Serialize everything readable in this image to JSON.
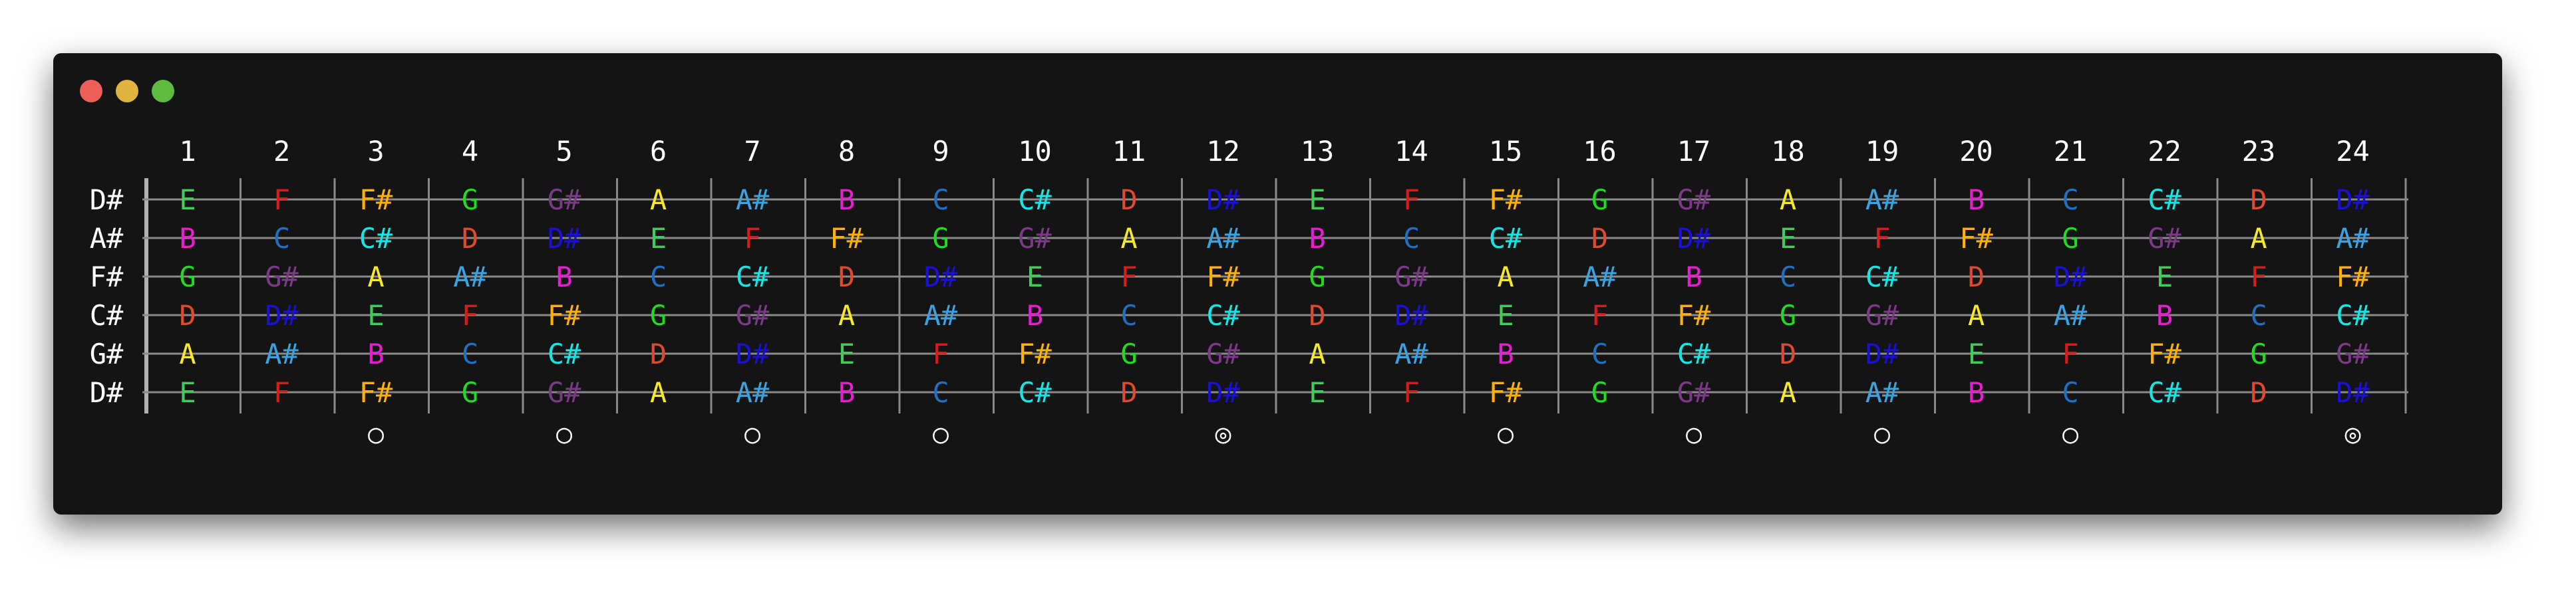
{
  "window": {
    "controls": [
      "close",
      "minimize",
      "maximize"
    ]
  },
  "fret_numbers": [
    "1",
    "2",
    "3",
    "4",
    "5",
    "6",
    "7",
    "8",
    "9",
    "10",
    "11",
    "12",
    "13",
    "14",
    "15",
    "16",
    "17",
    "18",
    "19",
    "20",
    "21",
    "22",
    "23",
    "24"
  ],
  "strings": [
    {
      "open": "D#",
      "notes": [
        "E",
        "F",
        "F#",
        "G",
        "G#",
        "A",
        "A#",
        "B",
        "C",
        "C#",
        "D",
        "D#",
        "E",
        "F",
        "F#",
        "G",
        "G#",
        "A",
        "A#",
        "B",
        "C",
        "C#",
        "D",
        "D#"
      ]
    },
    {
      "open": "A#",
      "notes": [
        "B",
        "C",
        "C#",
        "D",
        "D#",
        "E",
        "F",
        "F#",
        "G",
        "G#",
        "A",
        "A#",
        "B",
        "C",
        "C#",
        "D",
        "D#",
        "E",
        "F",
        "F#",
        "G",
        "G#",
        "A",
        "A#"
      ]
    },
    {
      "open": "F#",
      "notes": [
        "G",
        "G#",
        "A",
        "A#",
        "B",
        "C",
        "C#",
        "D",
        "D#",
        "E",
        "F",
        "F#",
        "G",
        "G#",
        "A",
        "A#",
        "B",
        "C",
        "C#",
        "D",
        "D#",
        "E",
        "F",
        "F#"
      ]
    },
    {
      "open": "C#",
      "notes": [
        "D",
        "D#",
        "E",
        "F",
        "F#",
        "G",
        "G#",
        "A",
        "A#",
        "B",
        "C",
        "C#",
        "D",
        "D#",
        "E",
        "F",
        "F#",
        "G",
        "G#",
        "A",
        "A#",
        "B",
        "C",
        "C#"
      ]
    },
    {
      "open": "G#",
      "notes": [
        "A",
        "A#",
        "B",
        "C",
        "C#",
        "D",
        "D#",
        "E",
        "F",
        "F#",
        "G",
        "G#",
        "A",
        "A#",
        "B",
        "C",
        "C#",
        "D",
        "D#",
        "E",
        "F",
        "F#",
        "G",
        "G#"
      ]
    },
    {
      "open": "D#",
      "notes": [
        "E",
        "F",
        "F#",
        "G",
        "G#",
        "A",
        "A#",
        "B",
        "C",
        "C#",
        "D",
        "D#",
        "E",
        "F",
        "F#",
        "G",
        "G#",
        "A",
        "A#",
        "B",
        "C",
        "C#",
        "D",
        "D#"
      ]
    }
  ],
  "note_colors": {
    "C": "#1f6fc2",
    "C#": "#14e6e6",
    "D": "#e0492c",
    "D#": "#1a10d8",
    "E": "#3fcd5a",
    "F": "#dd1a1a",
    "F#": "#ffb000",
    "G": "#1fdc1f",
    "G#": "#7a3a86",
    "A": "#f8e82a",
    "A#": "#3aa2e0",
    "B": "#e81cd0"
  },
  "inlays": [
    {
      "fret": 3,
      "symbol": "○"
    },
    {
      "fret": 5,
      "symbol": "○"
    },
    {
      "fret": 7,
      "symbol": "○"
    },
    {
      "fret": 9,
      "symbol": "○"
    },
    {
      "fret": 12,
      "symbol": "◎"
    },
    {
      "fret": 15,
      "symbol": "○"
    },
    {
      "fret": 17,
      "symbol": "○"
    },
    {
      "fret": 19,
      "symbol": "○"
    },
    {
      "fret": 21,
      "symbol": "○"
    },
    {
      "fret": 24,
      "symbol": "◎"
    }
  ],
  "theme": {
    "window_bg": "#141414",
    "text": "#ffffff",
    "line": "#8a8a8a",
    "nut": "#b0b0b0"
  }
}
